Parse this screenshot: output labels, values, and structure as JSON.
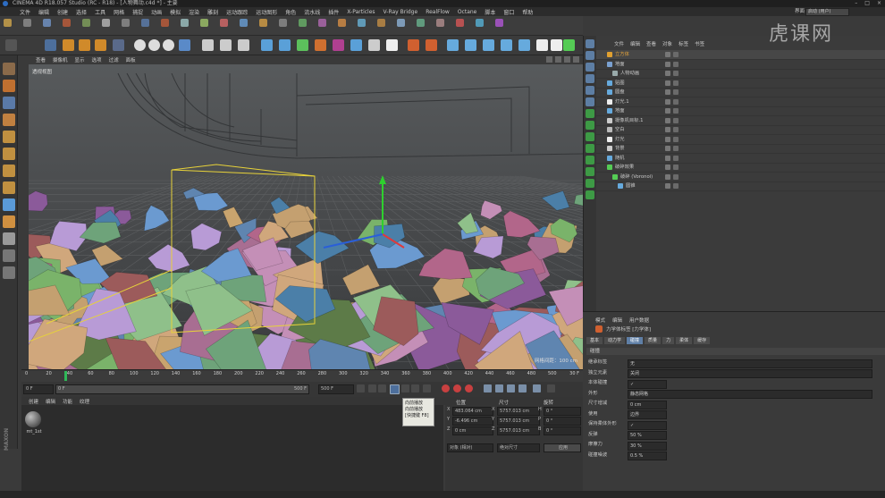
{
  "window": {
    "title": "CINEMA 4D R18.057 Studio (RC - R18) - [人物舞动.c4d *] - 主要"
  },
  "menu": {
    "items": [
      "文件",
      "编辑",
      "创建",
      "选择",
      "工具",
      "网格",
      "捕捉",
      "动画",
      "模拟",
      "渲染",
      "雕刻",
      "运动跟踪",
      "运动图形",
      "角色",
      "流水线",
      "插件",
      "X-Particles",
      "V-Ray Bridge",
      "RealFlow",
      "Octane",
      "脚本",
      "窗口",
      "帮助"
    ],
    "layout_label": "界面",
    "layout_value": "启动 (用户)"
  },
  "viewport": {
    "menu": [
      "查看",
      "摄像机",
      "显示",
      "选项",
      "过滤",
      "面板"
    ],
    "view_label": "透视视图",
    "grid_info": "网格间距：100 cm"
  },
  "timeline": {
    "ticks": [
      "0",
      "20",
      "40",
      "60",
      "80",
      "100",
      "120",
      "140",
      "160",
      "180",
      "200",
      "220",
      "240",
      "260",
      "280",
      "300",
      "320",
      "340",
      "360",
      "380",
      "400",
      "420",
      "440",
      "460",
      "480",
      "500"
    ],
    "current_frame": "30 F",
    "start_field": "0 F",
    "start_field2": "0 F",
    "end_field": "500 F",
    "end_field2": "500 F"
  },
  "tooltip": {
    "lines": [
      "向前播放",
      "向前播放",
      "[快捷键 F8]"
    ]
  },
  "material": {
    "menu": [
      "创建",
      "编辑",
      "功能",
      "纹理"
    ],
    "material_name": "mt_1st"
  },
  "coordinates": {
    "headers": [
      "位置",
      "尺寸",
      "旋转"
    ],
    "rows": [
      {
        "axis": "X",
        "pos": "483.064 cm",
        "size": "5757.013 cm",
        "rot_label": "H",
        "rot": "0 °"
      },
      {
        "axis": "Y",
        "pos": "-6.496 cm",
        "size": "5757.013 cm",
        "rot_label": "P",
        "rot": "0 °"
      },
      {
        "axis": "Z",
        "pos": "0 cm",
        "size": "5757.013 cm",
        "rot_label": "B",
        "rot": "0 °"
      }
    ],
    "mode_select": "对象 (相对)",
    "size_select": "绝对尺寸",
    "apply_label": "应用"
  },
  "object_manager": {
    "menu": [
      "文件",
      "编辑",
      "查看",
      "对象",
      "标签",
      "书签"
    ],
    "objects": [
      {
        "name": "立方体",
        "color": "#e0a030",
        "indent": 0,
        "hl": true
      },
      {
        "name": "地面",
        "color": "#7aa0d0",
        "indent": 0,
        "hl": false
      },
      {
        "name": "人物动画",
        "color": "#9aa",
        "indent": 6,
        "hl": false
      },
      {
        "name": "贴图",
        "color": "#6ad",
        "indent": 0,
        "hl": false
      },
      {
        "name": "圆盘",
        "color": "#6ad",
        "indent": 0,
        "hl": false
      },
      {
        "name": "灯光.1",
        "color": "#eee",
        "indent": 0,
        "hl": false
      },
      {
        "name": "地面",
        "color": "#6ad",
        "indent": 0,
        "hl": false
      },
      {
        "name": "摄像机目标.1",
        "color": "#ccc",
        "indent": 0,
        "hl": false
      },
      {
        "name": "空白",
        "color": "#bbb",
        "indent": 0,
        "hl": false
      },
      {
        "name": "灯光",
        "color": "#eee",
        "indent": 0,
        "hl": false
      },
      {
        "name": "背景",
        "color": "#ccc",
        "indent": 0,
        "hl": false
      },
      {
        "name": "随机",
        "color": "#6ad",
        "indent": 0,
        "hl": false
      },
      {
        "name": "破碎效果",
        "color": "#5c5",
        "indent": 0,
        "hl": false
      },
      {
        "name": "破碎 (Voronoi)",
        "color": "#5c5",
        "indent": 6,
        "hl": false
      },
      {
        "name": "圆锥",
        "color": "#6ad",
        "indent": 12,
        "hl": false
      }
    ]
  },
  "attribute_manager": {
    "menu": [
      "模式",
      "编辑",
      "用户数据"
    ],
    "object_title": "力学体标签 [力学体]",
    "tabs": [
      "基本",
      "动力学",
      "碰撞",
      "质量",
      "力",
      "柔体",
      "缓存"
    ],
    "active_tab": "碰撞",
    "section": "碰撞",
    "fields": [
      {
        "label": "继承标签",
        "value": "无"
      },
      {
        "label": "独立元素",
        "value": "关闭"
      },
      {
        "label": "本体碰撞",
        "value": "✓"
      },
      {
        "label": "外形",
        "value": "静态网格"
      },
      {
        "label": "尺寸增减",
        "value": "0 cm"
      },
      {
        "label": "使用",
        "value": "边界"
      },
      {
        "label": "保持柔体外形",
        "value": "✓"
      },
      {
        "label": "反弹",
        "value": "50 %"
      },
      {
        "label": "摩擦力",
        "value": "30 %"
      },
      {
        "label": "碰撞噪波",
        "value": "0.5 %"
      }
    ]
  },
  "watermark": "虎课网",
  "colors": {
    "accent": "#5f7fa6",
    "selection": "#e6a43a",
    "green_axis": "#2ed02e",
    "yellow_box": "#e7d23a"
  }
}
